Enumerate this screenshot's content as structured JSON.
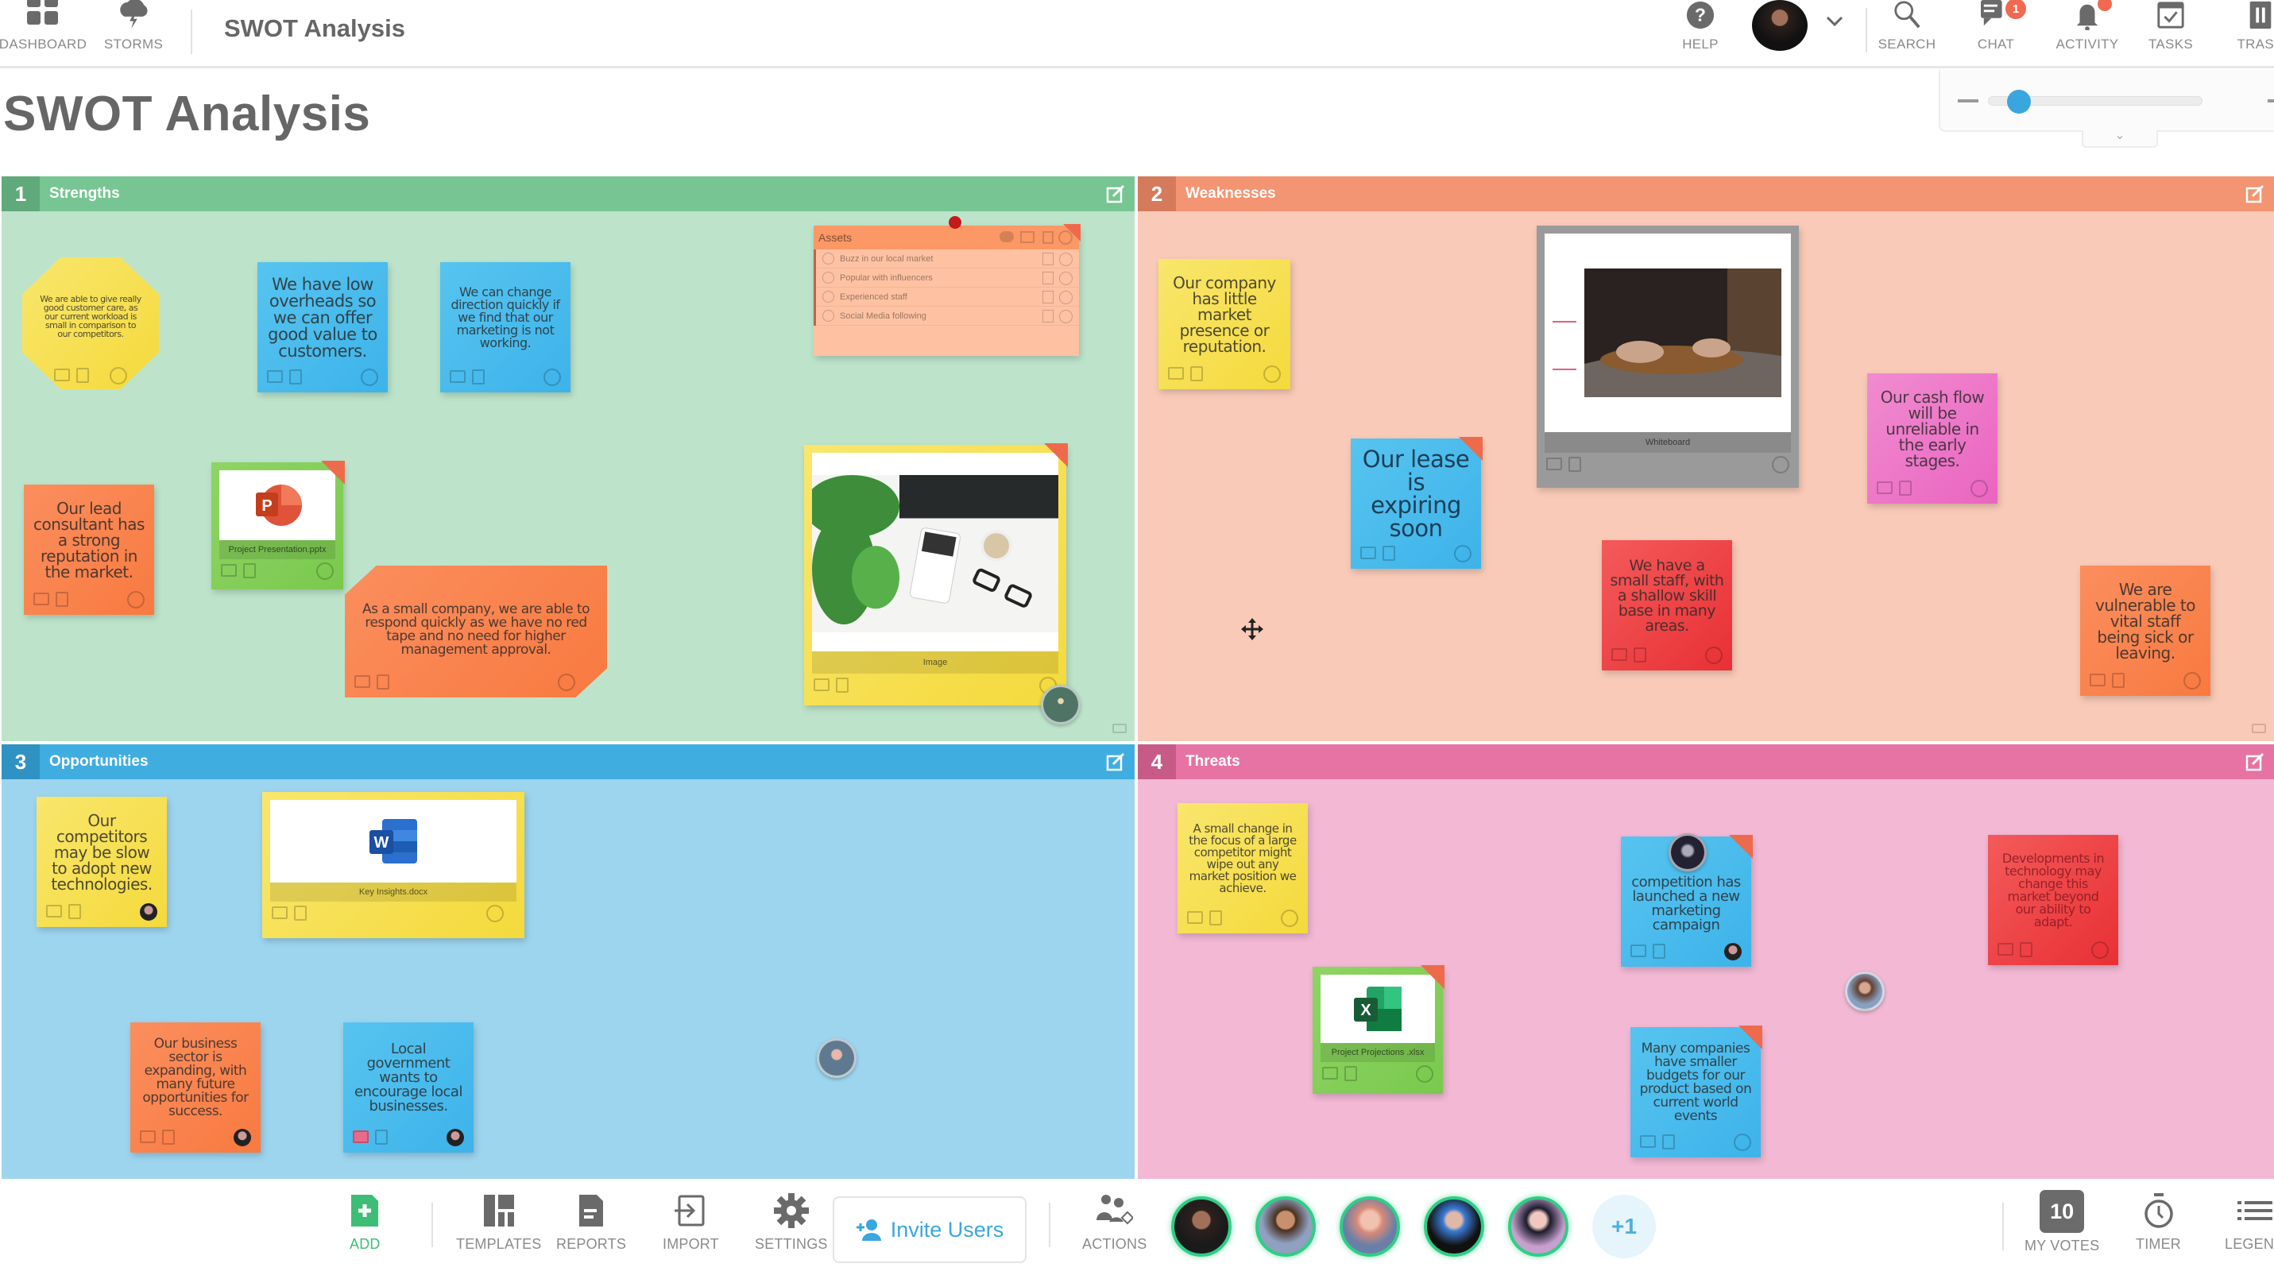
{
  "app": {
    "title": "SWOT Analysis",
    "nav_left": [
      {
        "label": "DASHBOARD",
        "icon": "dashboard-grid-icon"
      },
      {
        "label": "STORMS",
        "icon": "storm-cloud-icon"
      }
    ],
    "nav_right": [
      {
        "label": "HELP",
        "icon": "help-icon"
      },
      {
        "label": "SEARCH",
        "icon": "search-icon"
      },
      {
        "label": "CHAT",
        "icon": "chat-icon",
        "badge": "1"
      },
      {
        "label": "ACTIVITY",
        "icon": "bell-icon"
      },
      {
        "label": "TASKS",
        "icon": "tasks-icon"
      },
      {
        "label": "TRASH",
        "icon": "trash-icon"
      }
    ]
  },
  "page": {
    "title": "SWOT Analysis",
    "zoom_level_fraction": 0.09
  },
  "quadrants": [
    {
      "number": "1",
      "title": "Strengths",
      "colors": {
        "header": "#77c593",
        "num": "#5fa97a",
        "bg": "#bde4cb"
      },
      "notes": [
        {
          "text": "We are able to give really good customer care, as our current workload is small in comparison to our competitors.",
          "color": "yellow",
          "shape": "octagon"
        },
        {
          "text": "We have low overheads so we can offer good value to customers.",
          "color": "blue"
        },
        {
          "text": "We can change direction quickly if we find that our marketing is not working.",
          "color": "blue"
        },
        {
          "text": "Our lead consultant has a strong reputation in the market.",
          "color": "orange"
        },
        {
          "text": "As a small company, we are able to respond quickly as we have no red tape and no need for higher management approval.",
          "color": "orange",
          "shape": "clipped"
        }
      ],
      "files": [
        {
          "name": "Project Presentation.pptx",
          "type": "powerpoint",
          "color": "green"
        },
        {
          "name": "Image",
          "type": "image",
          "color": "yellow"
        }
      ],
      "list_card": {
        "title": "Assets",
        "items": [
          "Buzz in our local market",
          "Popular with influencers",
          "Experienced staff",
          "Social Media following"
        ]
      }
    },
    {
      "number": "2",
      "title": "Weaknesses",
      "colors": {
        "header": "#f39472",
        "num": "#d67a5c",
        "bg": "#f9cab7"
      },
      "notes": [
        {
          "text": "Our company has little market presence or reputation.",
          "color": "yellow"
        },
        {
          "text": "Our lease is expiring soon",
          "color": "blue"
        },
        {
          "text": "Our cash flow will be unreliable in the early stages.",
          "color": "pink"
        },
        {
          "text": "We have a small staff, with a shallow skill base in many areas.",
          "color": "red"
        },
        {
          "text": "We are vulnerable to vital staff being sick or leaving.",
          "color": "orange"
        }
      ],
      "files": [
        {
          "name": "Whiteboard",
          "type": "whiteboard",
          "color": "gray"
        }
      ]
    },
    {
      "number": "3",
      "title": "Opportunities",
      "colors": {
        "header": "#3fade0",
        "num": "#2f92c2",
        "bg": "#9dd5ef"
      },
      "notes": [
        {
          "text": "Our competitors may be slow to adopt new technologies.",
          "color": "yellow"
        },
        {
          "text": "Our business sector is expanding, with many future opportunities for success.",
          "color": "orange"
        },
        {
          "text": "Local government wants to encourage local businesses.",
          "color": "blue"
        }
      ],
      "files": [
        {
          "name": "Key Insights.docx",
          "type": "word",
          "color": "yellow"
        }
      ]
    },
    {
      "number": "4",
      "title": "Threats",
      "colors": {
        "header": "#e673a3",
        "num": "#c85a88",
        "bg": "#f2b8d4"
      },
      "notes": [
        {
          "text": "A small change in the focus of a large competitor might wipe out any market position we achieve.",
          "color": "yellow"
        },
        {
          "text": "competition has launched a new marketing campaign",
          "color": "blue"
        },
        {
          "text": "Developments in technology may change this market beyond our ability to adapt.",
          "color": "red"
        },
        {
          "text": "Many companies have smaller budgets for our product based on current world events",
          "color": "blue"
        }
      ],
      "files": [
        {
          "name": "Project Projections .xlsx",
          "type": "excel",
          "color": "green"
        }
      ]
    }
  ],
  "bottombar": {
    "tools_left": [
      {
        "label": "ADD",
        "icon": "add-note-icon",
        "color": "#3dbd76"
      },
      {
        "label": "TEMPLATES",
        "icon": "templates-icon"
      },
      {
        "label": "REPORTS",
        "icon": "reports-icon"
      },
      {
        "label": "IMPORT",
        "icon": "import-icon"
      },
      {
        "label": "SETTINGS",
        "icon": "gear-icon"
      }
    ],
    "invite_label": "Invite Users",
    "actions_label": "ACTIONS",
    "participants_more": "+1",
    "votes": "10",
    "tools_right": [
      {
        "label": "MY VOTES"
      },
      {
        "label": "TIMER",
        "icon": "timer-icon"
      },
      {
        "label": "LEGEND",
        "icon": "legend-icon"
      }
    ]
  },
  "colors": {
    "accent": "#3aa6de",
    "add": "#3dbd76",
    "badge": "#ef6a50",
    "online": "#2fce85"
  }
}
